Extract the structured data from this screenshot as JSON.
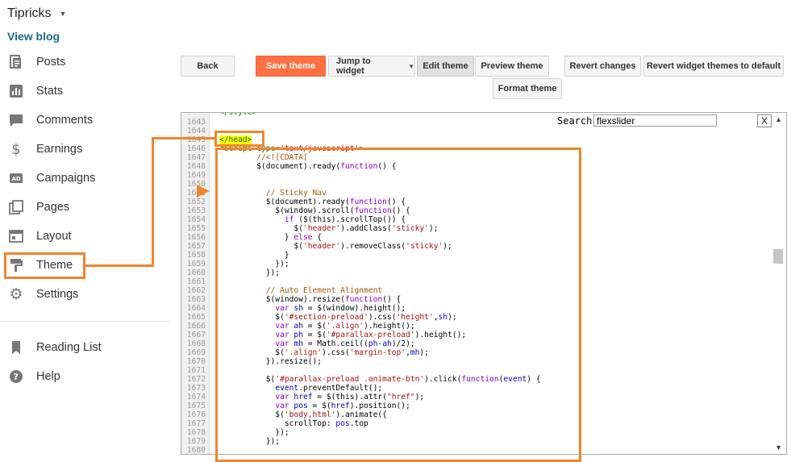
{
  "blog": {
    "title": "Tipricks",
    "view_blog": "View blog"
  },
  "nav": [
    {
      "label": "Posts",
      "icon": "posts-icon"
    },
    {
      "label": "Stats",
      "icon": "stats-icon"
    },
    {
      "label": "Comments",
      "icon": "comments-icon"
    },
    {
      "label": "Earnings",
      "icon": "dollar-icon"
    },
    {
      "label": "Campaigns",
      "icon": "campaigns-icon"
    },
    {
      "label": "Pages",
      "icon": "pages-icon"
    },
    {
      "label": "Layout",
      "icon": "layout-icon"
    },
    {
      "label": "Theme",
      "icon": "paint-roller-icon"
    },
    {
      "label": "Settings",
      "icon": "gear-icon"
    }
  ],
  "nav2": [
    {
      "label": "Reading List",
      "icon": "bookmark-icon"
    },
    {
      "label": "Help",
      "icon": "help-icon"
    }
  ],
  "toolbar": {
    "back": "Back",
    "save": "Save theme",
    "jump": "Jump to widget",
    "edit": "Edit theme",
    "preview": "Preview theme",
    "format": "Format theme",
    "revert": "Revert changes",
    "revert_widgets": "Revert widget themes to default"
  },
  "editor": {
    "search_label": "Search:",
    "search_value": "flexslider",
    "close": "X",
    "head_tag": "</head>",
    "line_numbers": [
      "1643",
      "1644",
      "1645",
      "1646",
      "1647",
      "1648",
      "1649",
      "1650",
      "1651",
      "1652",
      "1653",
      "1654",
      "1655",
      "1656",
      "1657",
      "1658",
      "1659",
      "1660",
      "1661",
      "1662",
      "1663",
      "1664",
      "1665",
      "1666",
      "1667",
      "1668",
      "1669",
      "1670",
      "1671",
      "1672",
      "1673",
      "1674",
      "1675",
      "1676",
      "1677",
      "1678",
      "1679",
      "1680"
    ],
    "code": [
      "",
      "",
      "",
      "<script type='text/javascript'>",
      "        //<![CDATA[",
      "        $(document).ready(function() {",
      "",
      "",
      "          // Sticky Nav",
      "          $(document).ready(function() {",
      "            $(window).scroll(function() {",
      "              if ($(this).scrollTop()) {",
      "                $('header').addClass('sticky');",
      "              } else {",
      "                $('header').removeClass('sticky');",
      "              }",
      "            });",
      "          });",
      "",
      "          // Auto Element Alignment",
      "          $(window).resize(function() {",
      "            var sh = $(window).height();",
      "            $('#section-preload').css('height',sh);",
      "            var ah = $('.align').height();",
      "            var ph = $('#parallax-preload').height();",
      "            var mh = Math.ceil((ph-ah)/2);",
      "            $('.align').css('margin-top',mh);",
      "          }).resize();",
      "",
      "          $('#parallax-preload .animate-btn').click(function(event) {",
      "            event.preventDefault();",
      "            var href = $(this).attr(\"href\");",
      "            var pos = $(href).position();",
      "            $('body,html').animate({",
      "              scrollTop: pos.top",
      "            });",
      "          });",
      ""
    ]
  },
  "colors": {
    "accent": "#f0852d",
    "save": "#ff7043",
    "link": "#1a6b8a"
  }
}
